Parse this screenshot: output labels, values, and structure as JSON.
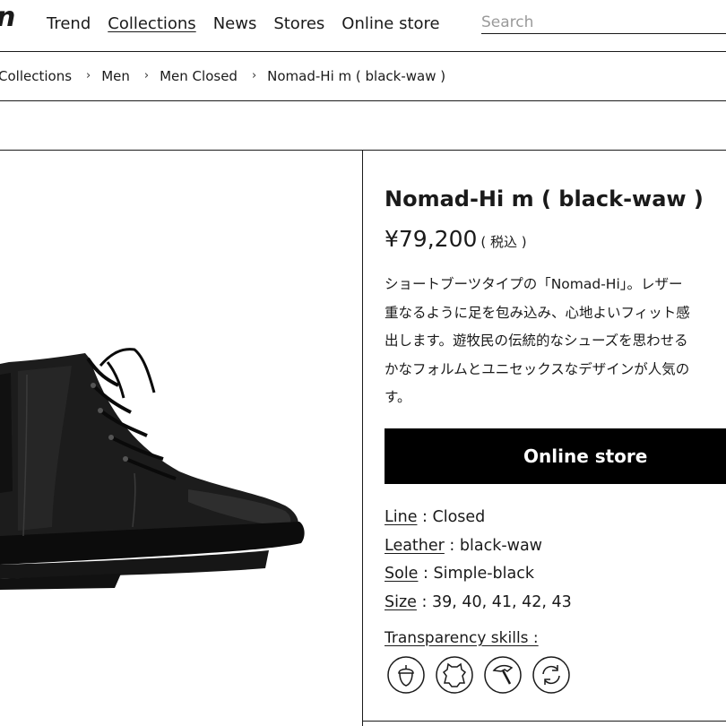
{
  "header": {
    "logo": "n",
    "nav": [
      "Trend",
      "Collections",
      "News",
      "Stores",
      "Online store"
    ],
    "search_placeholder": "Search"
  },
  "breadcrumb": [
    "Collections",
    "Men",
    "Men Closed",
    "Nomad-Hi m ( black-waw )"
  ],
  "breadcrumb_sep": "›",
  "product": {
    "title": "Nomad-Hi m ( black-waw )",
    "price": "¥79,200",
    "tax_note": "( 税込 )",
    "description_lines": [
      "ショートブーツタイプの「Nomad-Hi」。レザー",
      "重なるように足を包み込み、心地よいフィット感",
      "出します。遊牧民の伝統的なシューズを思わせる",
      "かなフォルムとユニセックスなデザインが人気の",
      "す。"
    ],
    "buy_label": "Online store",
    "specs": {
      "line_label": "Line",
      "line_value": " : Closed",
      "leather_label": "Leather",
      "leather_value": " : black-waw",
      "sole_label": "Sole",
      "sole_value": " : Simple-black",
      "size_label": "Size",
      "size_value": " : 39, 40, 41, 42, 43"
    },
    "skills_label": "Transparency skills :",
    "skill_icons": [
      "acorn-icon",
      "leather-hide-icon",
      "hammer-icon",
      "recycle-icon"
    ],
    "image_alt": "black leather lace-up ankle boot"
  }
}
